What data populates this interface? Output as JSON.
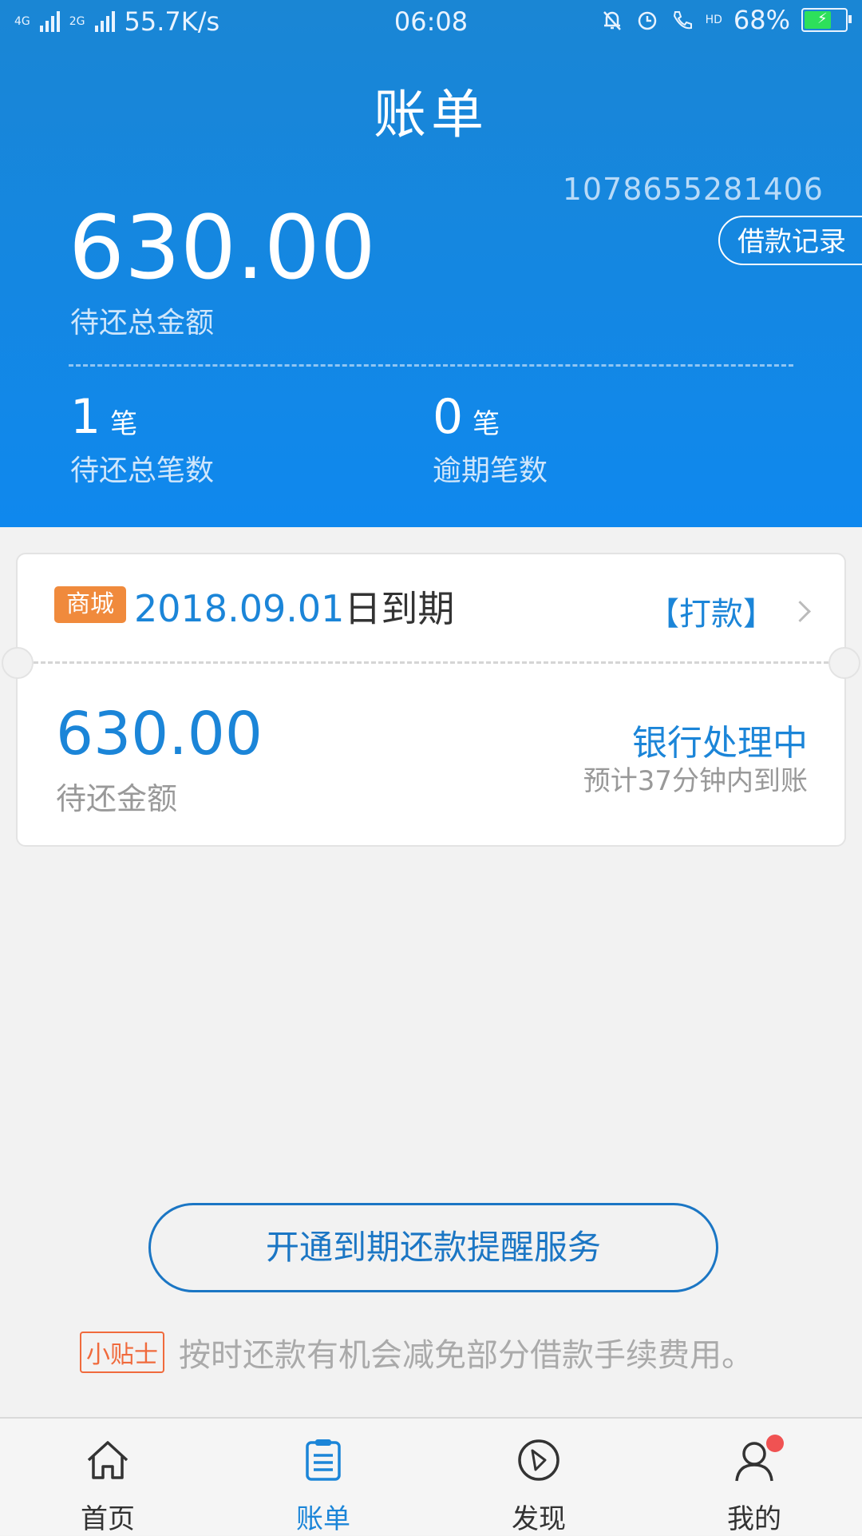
{
  "status_bar": {
    "network_speed": "55.7K/s",
    "time": "06:08",
    "battery": "68%",
    "battery_level": 0.68,
    "net_labels": [
      "4G",
      "4G",
      "2G"
    ],
    "hd_label": "HD"
  },
  "header": {
    "title": "账单",
    "account_number": "1078655281406",
    "loan_record_label": "借款记录",
    "total_amount": "630.00",
    "total_amount_label": "待还总金额",
    "pending_count": "1",
    "pending_unit": "笔",
    "pending_label": "待还总笔数",
    "overdue_count": "0",
    "overdue_unit": "笔",
    "overdue_label": "逾期笔数"
  },
  "bill_card": {
    "badge": "商城",
    "due_date": "2018.09.01",
    "due_suffix": "日到期",
    "action_label": "【打款】",
    "amount": "630.00",
    "amount_label": "待还金额",
    "status": "银行处理中",
    "eta": "预计37分钟内到账"
  },
  "reminder_button": "开通到期还款提醒服务",
  "tip": {
    "badge": "小贴士",
    "text": "按时还款有机会减免部分借款手续费用。"
  },
  "tabs": [
    {
      "label": "首页",
      "icon": "home-icon"
    },
    {
      "label": "账单",
      "icon": "bill-icon"
    },
    {
      "label": "发现",
      "icon": "compass-icon"
    },
    {
      "label": "我的",
      "icon": "user-icon"
    }
  ],
  "colors": {
    "accent": "#1b85d8",
    "header_bg": "#0f88ee",
    "badge_orange": "#f08a3c",
    "notification_dot": "#f05252"
  }
}
